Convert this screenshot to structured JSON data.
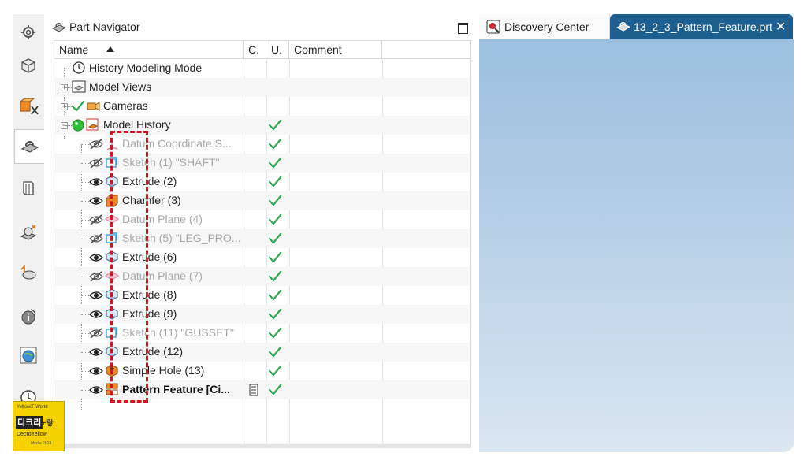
{
  "navigator": {
    "title": "Part Navigator",
    "columns": {
      "name": "Name",
      "c": "C.",
      "u": "U.",
      "comment": "Comment"
    }
  },
  "tree": [
    {
      "label": "History Modeling Mode",
      "icon": "clock-icon",
      "state": "normal",
      "check": false
    },
    {
      "label": "Model Views",
      "icon": "model-views-icon",
      "state": "normal",
      "check": false
    },
    {
      "label": "Cameras",
      "icon": "camera-icon",
      "state": "normal",
      "check": false
    },
    {
      "label": "Model History",
      "icon": "model-history-icon",
      "state": "normal",
      "check": true
    },
    {
      "label": "Datum Coordinate S...",
      "icon": "datum-csys-icon",
      "state": "dim",
      "check": true
    },
    {
      "label": "Sketch (1) \"SHAFT\"",
      "icon": "sketch-icon",
      "state": "dim",
      "check": true
    },
    {
      "label": "Extrude (2)",
      "icon": "extrude-icon",
      "state": "normal",
      "check": true
    },
    {
      "label": "Chamfer (3)",
      "icon": "chamfer-icon",
      "state": "normal",
      "check": true
    },
    {
      "label": "Datum Plane (4)",
      "icon": "datum-plane-icon",
      "state": "dim",
      "check": true
    },
    {
      "label": "Sketch (5) \"LEG_PRO...",
      "icon": "sketch-icon",
      "state": "dim",
      "check": true
    },
    {
      "label": "Extrude (6)",
      "icon": "extrude-icon",
      "state": "normal",
      "check": true
    },
    {
      "label": "Datum Plane (7)",
      "icon": "datum-plane-icon",
      "state": "dim",
      "check": true
    },
    {
      "label": "Extrude (8)",
      "icon": "extrude-icon",
      "state": "normal",
      "check": true
    },
    {
      "label": "Extrude (9)",
      "icon": "extrude-icon",
      "state": "normal",
      "check": true
    },
    {
      "label": "Sketch (11) \"GUSSET\"",
      "icon": "sketch-icon",
      "state": "dim",
      "check": true
    },
    {
      "label": "Extrude (12)",
      "icon": "extrude-icon",
      "state": "normal",
      "check": true
    },
    {
      "label": "Simple Hole (13)",
      "icon": "hole-icon",
      "state": "normal",
      "check": true
    },
    {
      "label": "Pattern Feature [Ci...",
      "icon": "pattern-icon",
      "state": "bold",
      "check": true
    }
  ],
  "tabs": {
    "discovery": "Discovery Center",
    "part": "13_2_3_Pattern_Feature.prt",
    "close": "✕"
  },
  "logo": {
    "line1": "YellowIT World",
    "line2": "디크리",
    "line3": "노랗",
    "line4": "DecroYellow",
    "line5": "Media 2024"
  },
  "colors": {
    "check": "#2fa84f",
    "tab_active": "#1f5f8f",
    "highlight": "#d0151d"
  }
}
